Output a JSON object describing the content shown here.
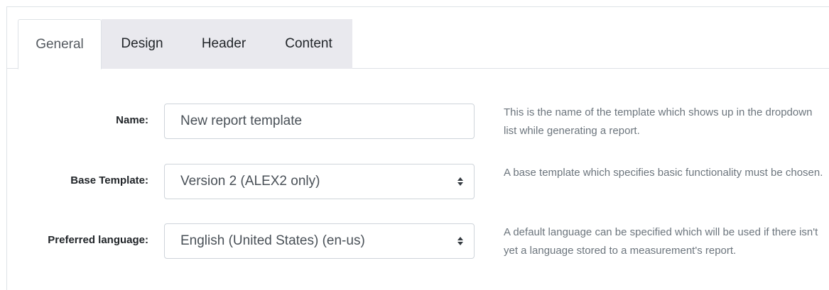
{
  "tabs": [
    {
      "label": "General",
      "active": true
    },
    {
      "label": "Design",
      "active": false
    },
    {
      "label": "Header",
      "active": false
    },
    {
      "label": "Content",
      "active": false
    }
  ],
  "form": {
    "name": {
      "label": "Name:",
      "value": "New report template",
      "help": "This is the name of the template which shows up in the dropdown list while generating a report."
    },
    "base_template": {
      "label": "Base Template:",
      "value": "Version 2 (ALEX2 only)",
      "help": "A base template which specifies basic functionality must be chosen."
    },
    "preferred_language": {
      "label": "Preferred language:",
      "value": "English (United States) (en-us)",
      "help": "A default language can be specified which will be used if there isn't yet a language stored to a measurement's report."
    }
  },
  "colors": {
    "border": "#dee2e6",
    "inactive_tab_bg": "#e9e9ee",
    "help_text": "#6c757d",
    "input_text": "#495057"
  }
}
